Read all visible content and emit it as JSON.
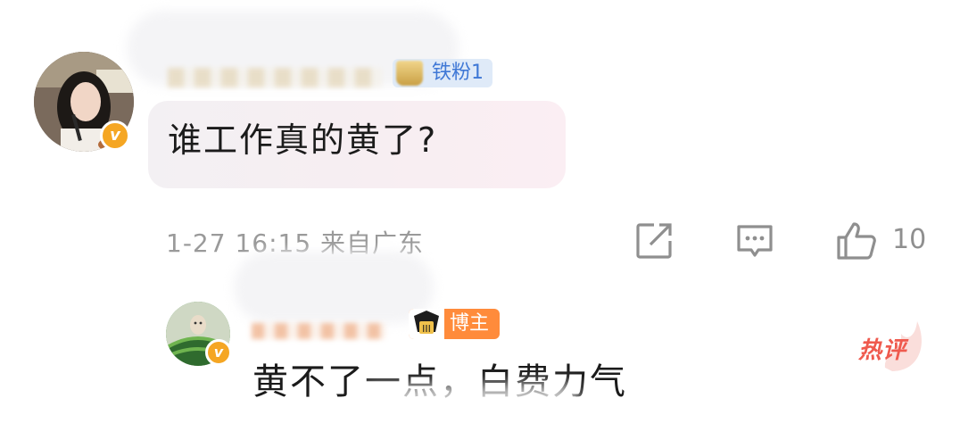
{
  "main_comment": {
    "user_badge": "铁粉1",
    "text": "谁工作真的黄了?",
    "meta": "1-27 16:15  来自广东",
    "like_count": "10",
    "actions": [
      "share-icon",
      "comment-icon",
      "like-icon"
    ]
  },
  "reply": {
    "user_badge": "博主",
    "text": "黄不了一点，白费力气",
    "hot_tag": "热评"
  },
  "colors": {
    "fan_badge_bg": "#dfeaf8",
    "fan_badge_text": "#3f78d6",
    "blogger_badge_bg": "#ff8b3b",
    "verified_badge": "#f5a623",
    "hot_tag": "#ef5a4e",
    "meta_gray": "#9a9a9a"
  }
}
